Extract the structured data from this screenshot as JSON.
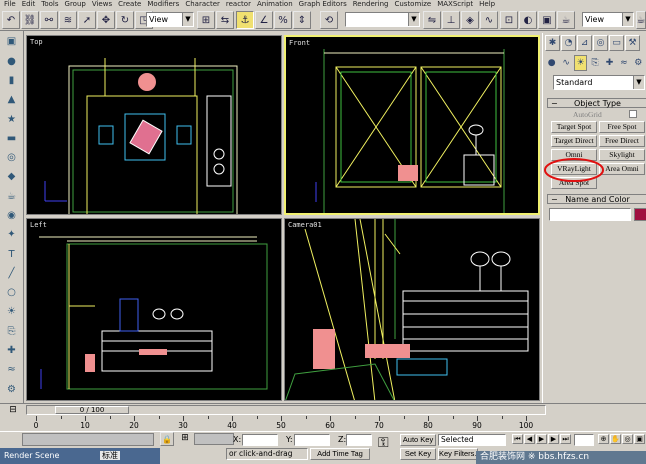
{
  "menu": [
    "File",
    "Edit",
    "Tools",
    "Group",
    "Views",
    "Create",
    "Modifiers",
    "Character",
    "reactor",
    "Animation",
    "Graph Editors",
    "Rendering",
    "Customize",
    "MAXScript",
    "Help"
  ],
  "toolbar": {
    "view_dropdown": "View",
    "view_dropdown_right": "View",
    "selection_set": ""
  },
  "viewports": {
    "top_label": "Top",
    "front_label": "Front",
    "left_label": "Left",
    "camera_label": "Camera01"
  },
  "command_panel": {
    "category_dropdown": "Standard",
    "object_type_header": "Object Type",
    "autogrid_label": "AutoGrid",
    "buttons": [
      "Target Spot",
      "Free Spot",
      "Target Direct",
      "Free Direct",
      "Omni",
      "Skylight",
      "VRayLight",
      "Area Omni",
      "Area Spot"
    ],
    "name_color_header": "Name and Color",
    "name_value": "",
    "highlight_color": "#e01010"
  },
  "timeline": {
    "frame_display": "0 / 100",
    "ticks": [
      "0",
      "10",
      "20",
      "30",
      "40",
      "50",
      "60",
      "70",
      "80",
      "90",
      "100"
    ]
  },
  "status": {
    "x_label": "X:",
    "y_label": "Y:",
    "z_label": "Z:",
    "auto_key": "Auto Key",
    "set_key": "Set Key",
    "selected": "Selected",
    "key_filters": "Key Filters...",
    "prompt": "or click-and-drag",
    "add_time_tag": "Add Time Tag",
    "render_scene": "Render Scene",
    "ime": "标准",
    "watermark": "合肥装饰网 ※ bbs.hfzs.cn"
  }
}
